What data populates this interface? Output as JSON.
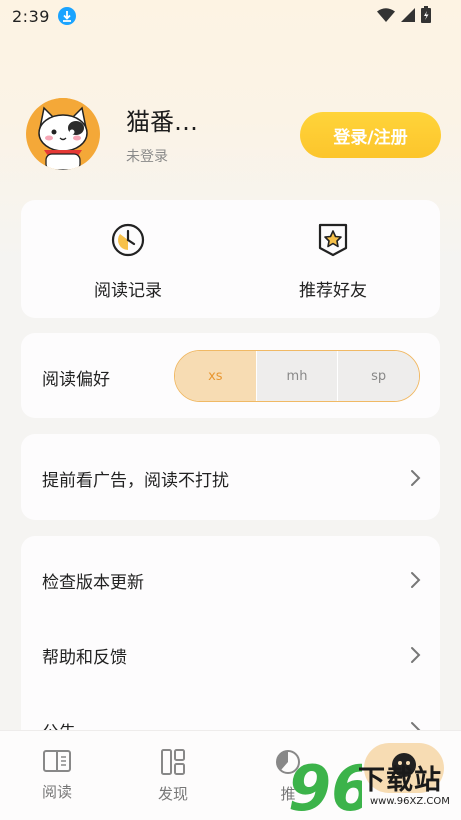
{
  "status_bar": {
    "time": "2:39",
    "icons": [
      "download-icon",
      "wifi-icon",
      "signal-icon",
      "battery-icon"
    ]
  },
  "profile": {
    "username": "猫番…",
    "login_status": "未登录",
    "login_button": "登录/注册"
  },
  "quick_actions": [
    {
      "label": "阅读记录",
      "icon": "clock-icon"
    },
    {
      "label": "推荐好友",
      "icon": "star-badge-icon"
    }
  ],
  "reading_preference": {
    "label": "阅读偏好",
    "options": [
      "xs",
      "mh",
      "sp"
    ],
    "selected": "xs"
  },
  "ad_row": {
    "label": "提前看广告，阅读不打扰"
  },
  "settings": [
    {
      "label": "检查版本更新"
    },
    {
      "label": "帮助和反馈"
    },
    {
      "label": "公告"
    }
  ],
  "bottom_nav": [
    {
      "label": "阅读",
      "icon": "book-icon"
    },
    {
      "label": "发现",
      "icon": "discover-icon"
    },
    {
      "label": "推",
      "icon": "recommend-icon"
    },
    {
      "label": "",
      "icon": "profile-icon"
    }
  ],
  "watermark": {
    "number": "96",
    "text": "下载站",
    "url": "www.96XZ.COM"
  },
  "colors": {
    "accent": "#fcc52c",
    "selected_bg": "#f7dcb3",
    "selected_text": "#e8962f",
    "background": "#f5f4f2"
  }
}
